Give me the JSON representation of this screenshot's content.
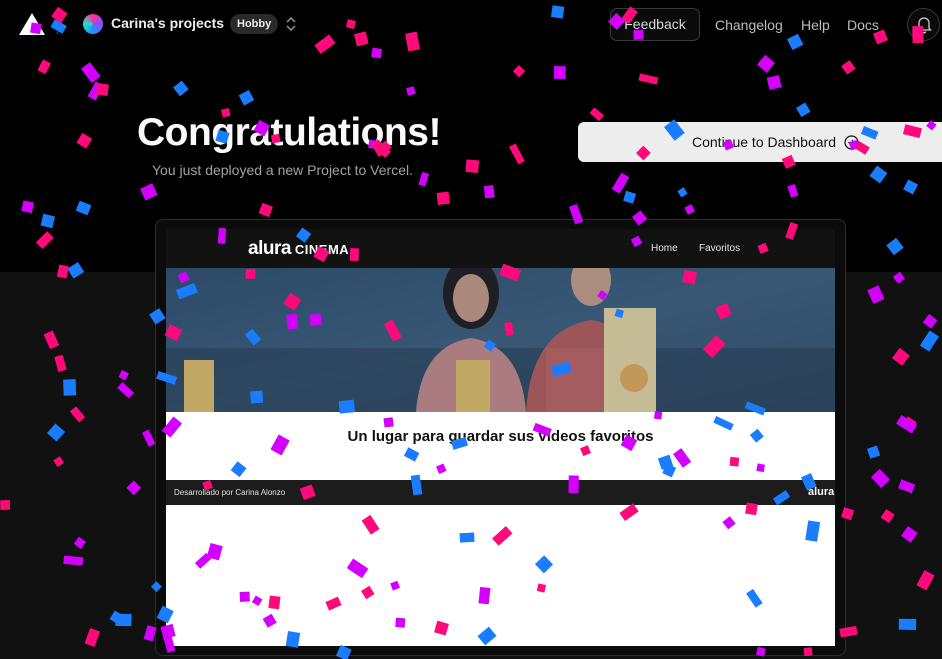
{
  "header": {
    "team_name": "Carina's projects",
    "plan_badge": "Hobby",
    "feedback_label": "Feedback",
    "nav_links": [
      "Changelog",
      "Help",
      "Docs"
    ]
  },
  "hero": {
    "title": "Congratulations!",
    "subtitle": "You just deployed a new Project to Vercel.",
    "dashboard_button": "Continue to Dashboard"
  },
  "preview": {
    "brand_main": "alura",
    "brand_sub": "CINEMA",
    "nav": [
      "Home",
      "Favoritos"
    ],
    "heading": "Un lugar para guardar sus videos favoritos",
    "footer_credit": "Desarrollado por Carina Alonzo",
    "footer_logo": "alura"
  },
  "colors": {
    "background": "#000000",
    "confetti": [
      "#ff0a78",
      "#d400ff",
      "#1a7dff"
    ]
  },
  "icons": [
    "vercel-logo-icon",
    "slash-icon",
    "chevron-updown-icon",
    "bell-icon",
    "arrow-circle-right-icon"
  ]
}
